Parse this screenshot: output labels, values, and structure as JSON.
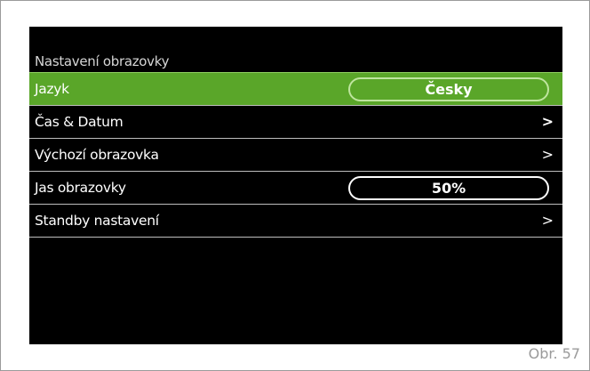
{
  "screen": {
    "title": "Nastavení obrazovky"
  },
  "menu": {
    "items": [
      {
        "label": "Jazyk",
        "value": "Česky",
        "selected": true
      },
      {
        "label": "Čas & Datum",
        "arrow": ">"
      },
      {
        "label": "Výchozí obrazovka",
        "arrow": ">"
      },
      {
        "label": "Jas obrazovky",
        "value": "50%"
      },
      {
        "label": "Standby nastavení",
        "arrow": ">"
      }
    ]
  },
  "figure": {
    "label": "Obr. 57"
  },
  "colors": {
    "selected_background": "#5aa629",
    "screen_background": "#000000",
    "text": "#ffffff",
    "divider": "#bdbdbd"
  },
  "icons": {
    "arrow": "chevron-right-icon"
  }
}
